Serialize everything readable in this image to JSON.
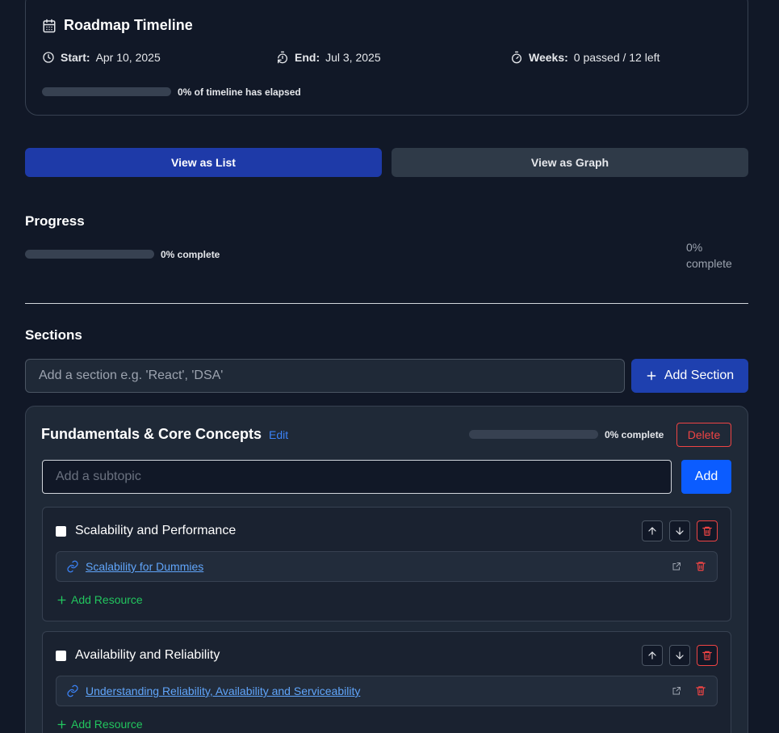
{
  "timeline": {
    "title": "Roadmap Timeline",
    "start_label": "Start:",
    "start_value": "Apr 10, 2025",
    "end_label": "End:",
    "end_value": "Jul 3, 2025",
    "weeks_label": "Weeks:",
    "weeks_value": "0 passed / 12 left",
    "elapsed_text": "0% of timeline has elapsed",
    "elapsed_fraction": 0
  },
  "view_toggle": {
    "list_label": "View as List",
    "graph_label": "View as Graph"
  },
  "progress": {
    "heading": "Progress",
    "complete_text": "0% complete",
    "complete_fraction": 0,
    "side_text": "0% complete"
  },
  "sections": {
    "heading": "Sections",
    "input_placeholder": "Add a section e.g. 'React', 'DSA'",
    "add_button_label": "Add Section",
    "items": [
      {
        "title": "Fundamentals & Core Concepts",
        "edit_label": "Edit",
        "complete_text": "0% complete",
        "complete_fraction": 0,
        "delete_label": "Delete",
        "subtopic_placeholder": "Add a subtopic",
        "add_label": "Add",
        "subtopics": [
          {
            "title": "Scalability and Performance",
            "checked": false,
            "resources": [
              {
                "label": "Scalability for Dummies"
              }
            ],
            "add_resource_label": "Add Resource"
          },
          {
            "title": "Availability and Reliability",
            "checked": false,
            "resources": [
              {
                "label": "Understanding Reliability, Availability and Serviceability"
              }
            ],
            "add_resource_label": "Add Resource"
          }
        ]
      }
    ]
  },
  "colors": {
    "background": "#111827",
    "card": "#1f2937",
    "primary": "#1e3aa8",
    "accent_blue": "#0b5cff",
    "link": "#60a5fa",
    "danger": "#ef4444",
    "success": "#22c55e"
  },
  "icons": [
    "calendar-icon",
    "clock-icon",
    "timer-reset-icon",
    "stopwatch-icon",
    "plus-icon",
    "arrow-up-icon",
    "arrow-down-icon",
    "trash-icon",
    "link-icon",
    "external-link-icon"
  ]
}
